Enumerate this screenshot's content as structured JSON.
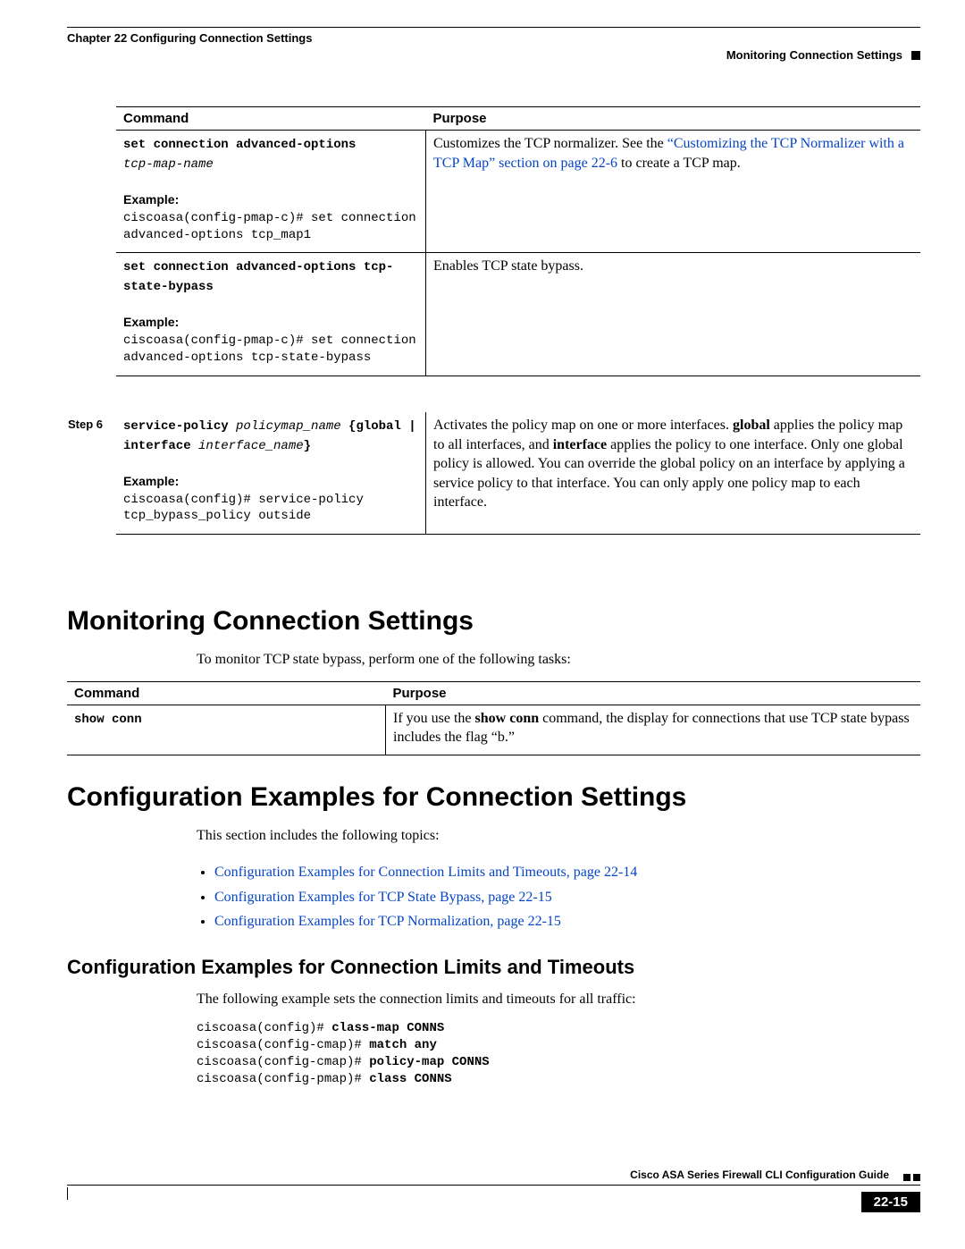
{
  "header": {
    "chapter": "Chapter 22    Configuring Connection Settings",
    "section": "Monitoring Connection Settings"
  },
  "table1": {
    "col1": "Command",
    "col2": "Purpose",
    "row1": {
      "cmd_bold": "set connection advanced-options",
      "cmd_italic": "tcp-map-name",
      "example_label": "Example:",
      "example_code": "ciscoasa(config-pmap-c)# set connection advanced-options tcp_map1",
      "purpose_pre": "Customizes the TCP normalizer. See the ",
      "purpose_link": "“Customizing the TCP Normalizer with a TCP Map” section on page 22-6",
      "purpose_post": " to create a TCP map."
    },
    "row2": {
      "cmd_bold": "set connection advanced-options tcp-state-bypass",
      "example_label": "Example:",
      "example_code": "ciscoasa(config-pmap-c)# set connection advanced-options tcp-state-bypass",
      "purpose": "Enables TCP state bypass."
    },
    "row3": {
      "step": "Step 6",
      "cmd_b1": "service-policy",
      "cmd_i1": " policymap_name ",
      "cmd_b2": "{global | interface ",
      "cmd_i2": "interface_name",
      "cmd_b3": "}",
      "example_label": "Example:",
      "example_code": "ciscoasa(config)# service-policy tcp_bypass_policy outside",
      "purpose_a": "Activates the policy map on one or more interfaces. ",
      "purpose_b1": "global",
      "purpose_b": " applies the policy map to all interfaces, and ",
      "purpose_b2": "interface",
      "purpose_c": " applies the policy to one interface. Only one global policy is allowed. You can override the global policy on an interface by applying a service policy to that interface. You can only apply one policy map to each interface."
    }
  },
  "section1": {
    "heading": "Monitoring Connection Settings",
    "intro": "To monitor TCP state bypass, perform one of the following tasks:"
  },
  "table2": {
    "col1": "Command",
    "col2": "Purpose",
    "row1": {
      "cmd": "show conn",
      "p_a": "If you use the ",
      "p_b": "show conn",
      "p_c": " command, the display for connections that use TCP state bypass includes the flag “b.”"
    }
  },
  "section2": {
    "heading": "Configuration Examples for Connection Settings",
    "intro": "This section includes the following topics:",
    "links": [
      "Configuration Examples for Connection Limits and Timeouts, page 22-14",
      "Configuration Examples for TCP State Bypass, page 22-15",
      "Configuration Examples for TCP Normalization, page 22-15"
    ]
  },
  "section3": {
    "heading": "Configuration Examples for Connection Limits and Timeouts",
    "intro": "The following example sets the connection limits and timeouts for all traffic:",
    "code": {
      "l1a": "ciscoasa(config)# ",
      "l1b": "class-map CONNS",
      "l2a": "ciscoasa(config-cmap)# ",
      "l2b": "match any",
      "l3a": "ciscoasa(config-cmap)# ",
      "l3b": "policy-map CONNS",
      "l4a": "ciscoasa(config-pmap)# ",
      "l4b": "class CONNS"
    }
  },
  "footer": {
    "guide": "Cisco ASA Series Firewall CLI Configuration Guide",
    "pagenum": "22-15"
  }
}
